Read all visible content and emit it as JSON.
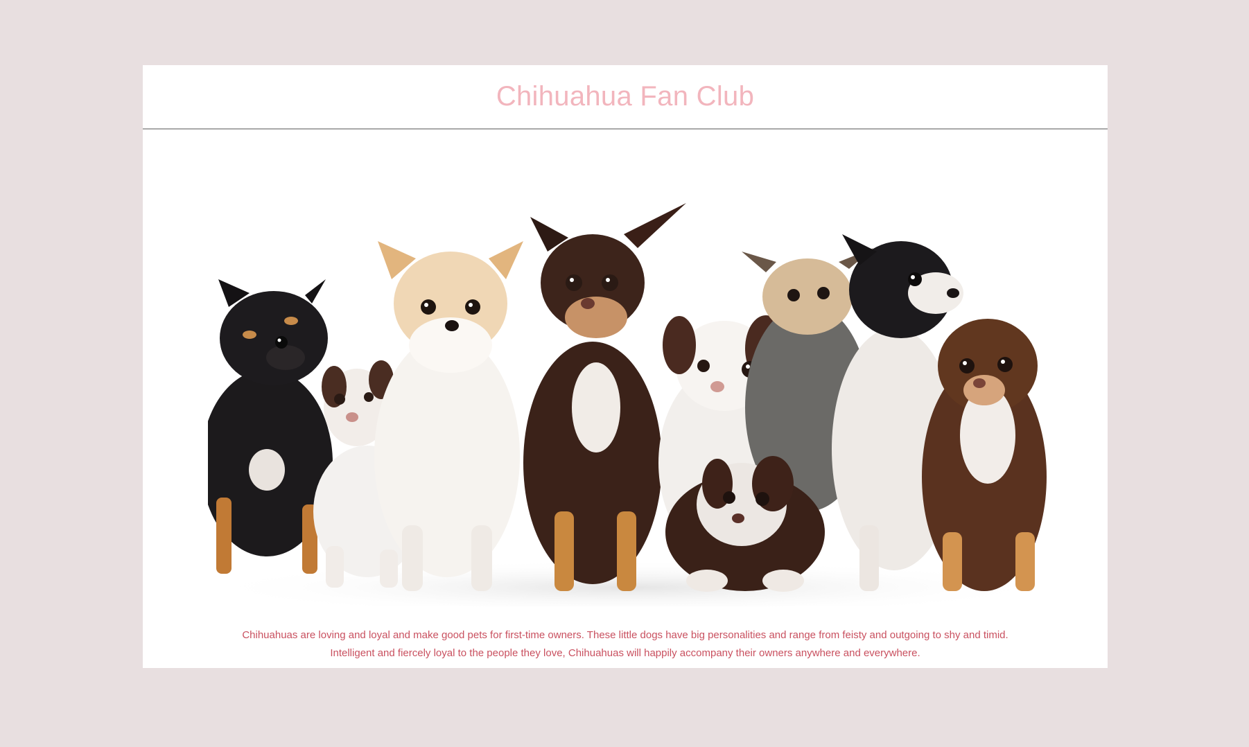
{
  "header": {
    "title": "Chihuahua Fan Club"
  },
  "main": {
    "image_subject": "group of nine chihuahuas",
    "description": "Chihuahuas are loving and loyal and make good pets for first-time owners. These little dogs have big personalities and range from feisty and outgoing to shy and timid. Intelligent and fiercely loyal to the people they love, Chihuahuas will happily accompany their owners anywhere and everywhere."
  },
  "colors": {
    "page_background": "#e8dfe0",
    "card_background": "#ffffff",
    "title": "#f2b5bd",
    "description_text": "#c9505f",
    "divider": "#a9a9a9"
  }
}
